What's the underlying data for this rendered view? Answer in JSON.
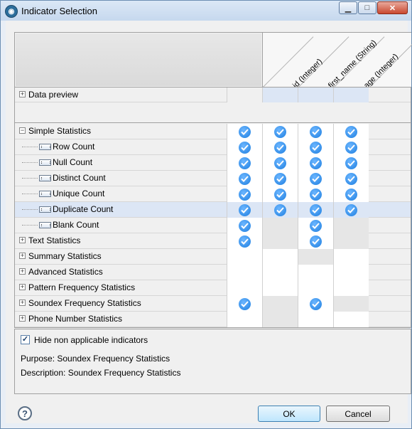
{
  "window": {
    "title": "Indicator Selection"
  },
  "columns": [
    "id (Integer)",
    "first_name (String)",
    "age (Integer)"
  ],
  "preview": {
    "label": "Data preview"
  },
  "rows": [
    {
      "name": "Simple Statistics",
      "kind": "group",
      "expanded": true,
      "cells": [
        "check",
        "check",
        "check",
        "check"
      ],
      "bg": [
        "white",
        "white",
        "white",
        "white"
      ]
    },
    {
      "name": "Row Count",
      "kind": "leaf",
      "cells": [
        "check",
        "check",
        "check",
        "check"
      ],
      "bg": [
        "white",
        "white",
        "white",
        "white"
      ]
    },
    {
      "name": "Null Count",
      "kind": "leaf",
      "cells": [
        "check",
        "check",
        "check",
        "check"
      ],
      "bg": [
        "white",
        "white",
        "white",
        "white"
      ]
    },
    {
      "name": "Distinct Count",
      "kind": "leaf",
      "cells": [
        "check",
        "check",
        "check",
        "check"
      ],
      "bg": [
        "white",
        "white",
        "white",
        "white"
      ]
    },
    {
      "name": "Unique Count",
      "kind": "leaf",
      "cells": [
        "check",
        "check",
        "check",
        "check"
      ],
      "bg": [
        "white",
        "white",
        "white",
        "white"
      ]
    },
    {
      "name": "Duplicate Count",
      "kind": "leaf",
      "selected": true,
      "cells": [
        "check",
        "check",
        "check",
        "check"
      ],
      "bg": [
        "blue",
        "blue",
        "blue",
        "blue"
      ]
    },
    {
      "name": "Blank Count",
      "kind": "leaf",
      "cells": [
        "check",
        "",
        "check",
        ""
      ],
      "bg": [
        "white",
        "grey",
        "white",
        "grey"
      ]
    },
    {
      "name": "Text Statistics",
      "kind": "group",
      "cells": [
        "check",
        "",
        "check",
        ""
      ],
      "bg": [
        "white",
        "grey",
        "white",
        "grey"
      ]
    },
    {
      "name": "Summary Statistics",
      "kind": "group",
      "cells": [
        "",
        "",
        "",
        ""
      ],
      "bg": [
        "white",
        "white",
        "grey",
        "white"
      ]
    },
    {
      "name": "Advanced Statistics",
      "kind": "group",
      "cells": [
        "",
        "",
        "",
        ""
      ],
      "bg": [
        "white",
        "white",
        "white",
        "white"
      ]
    },
    {
      "name": "Pattern Frequency Statistics",
      "kind": "group",
      "cells": [
        "",
        "",
        "",
        ""
      ],
      "bg": [
        "white",
        "white",
        "white",
        "white"
      ]
    },
    {
      "name": "Soundex Frequency Statistics",
      "kind": "group",
      "cells": [
        "check",
        "",
        "check",
        ""
      ],
      "bg": [
        "white",
        "grey",
        "white",
        "grey"
      ]
    },
    {
      "name": "Phone Number Statistics",
      "kind": "group",
      "cells": [
        "",
        "",
        "",
        ""
      ],
      "bg": [
        "white",
        "grey",
        "white",
        "white"
      ]
    }
  ],
  "options": {
    "hide_label": "Hide non applicable indicators",
    "hide_checked": true,
    "purpose": "Purpose: Soundex Frequency Statistics",
    "description": "Description: Soundex Frequency Statistics"
  },
  "buttons": {
    "ok": "OK",
    "cancel": "Cancel"
  },
  "colors": {
    "check": "#1e7fe0",
    "selected_row": "#dce6f5"
  }
}
